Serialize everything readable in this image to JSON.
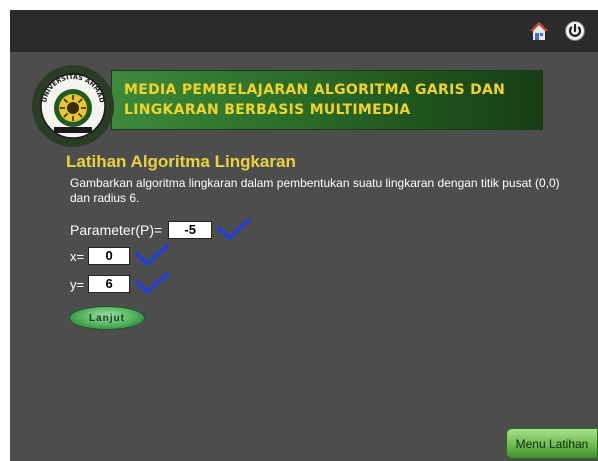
{
  "header": {
    "home_icon": "home-icon",
    "power_icon": "power-icon"
  },
  "banner": {
    "logo_text": "UNIVERSITAS AHMAD DAHLAN",
    "title": "MEDIA PEMBELAJARAN ALGORITMA GARIS DAN LINGKARAN BERBASIS MULTIMEDIA"
  },
  "exercise": {
    "title": "Latihan Algoritma Lingkaran",
    "description": "Gambarkan algoritma lingkaran dalam pembentukan suatu lingkaran dengan titik pusat (0,0) dan radius 6.",
    "fields": [
      {
        "label": "Parameter(P)=",
        "value": "-5",
        "status_icon": "check-icon"
      },
      {
        "label": "x=",
        "value": "0",
        "status_icon": "check-icon"
      },
      {
        "label": "y=",
        "value": "6",
        "status_icon": "check-icon"
      }
    ],
    "next_button": "Lanjut"
  },
  "footer": {
    "menu_button": "Menu Latihan"
  },
  "colors": {
    "background": "#4d4d4d",
    "topbar": "#2b2b2b",
    "title_yellow": "#e8d33f",
    "banner_green": "#2a6a28",
    "check_blue": "#1f3fe0"
  }
}
